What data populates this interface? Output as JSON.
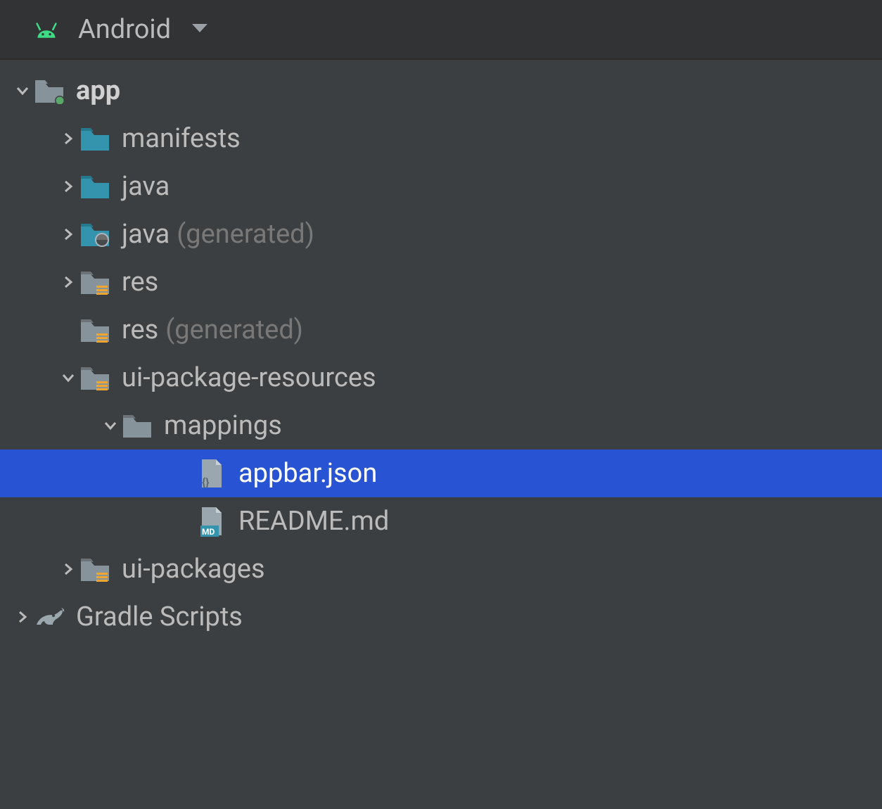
{
  "header": {
    "view": "Android"
  },
  "tree": {
    "app": {
      "label": "app",
      "children": {
        "manifests": {
          "label": "manifests"
        },
        "java": {
          "label": "java"
        },
        "java_gen": {
          "label": "java",
          "suffix": "(generated)"
        },
        "res": {
          "label": "res"
        },
        "res_gen": {
          "label": "res",
          "suffix": "(generated)"
        },
        "ui_pkg_res": {
          "label": "ui-package-resources",
          "children": {
            "mappings": {
              "label": "mappings",
              "children": {
                "appbar": {
                  "label": "appbar.json"
                },
                "readme": {
                  "label": "README.md"
                }
              }
            }
          }
        },
        "ui_packages": {
          "label": "ui-packages"
        }
      }
    },
    "gradle": {
      "label": "Gradle Scripts"
    }
  }
}
